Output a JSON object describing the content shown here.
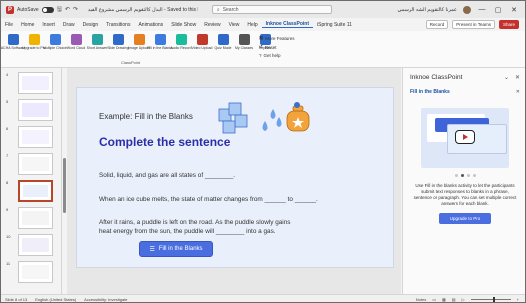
{
  "titlebar": {
    "autosave_label": "AutoSave",
    "file_title": "البدل كالتقويم الرسمي مشروع الفيد - Saved to this PC",
    "search_placeholder": "Search",
    "user_name": "عمرنا كالتقويم الشه الرسمي",
    "min": "—",
    "max": "▢",
    "close": "✕"
  },
  "menu": {
    "tabs": [
      "File",
      "Home",
      "Insert",
      "Draw",
      "Design",
      "Transitions",
      "Animations",
      "Slide Show",
      "Review",
      "View",
      "Help",
      "Inknoe ClassPoint",
      "iSpring Suite 11"
    ],
    "active_index": 11,
    "record": "Record",
    "present": "Present in Teams",
    "share": "Share"
  },
  "ribbon": {
    "buttons": [
      {
        "label": "ACHA Software",
        "color": "#2f6ac9"
      },
      {
        "label": "Upgrade to Pro",
        "color": "#f0b400"
      },
      {
        "label": "Multiple Choice",
        "color": "#3d7be0"
      },
      {
        "label": "Word Cloud",
        "color": "#9b59b6"
      },
      {
        "label": "Short Answer",
        "color": "#2aa3a3"
      },
      {
        "label": "Slide Drawing",
        "color": "#2f6ac9"
      },
      {
        "label": "Image Upload",
        "color": "#e67e22"
      },
      {
        "label": "Fill in the Blanks",
        "color": "#3d7be0"
      },
      {
        "label": "Audio Record",
        "color": "#1abc9c"
      },
      {
        "label": "Video Upload",
        "color": "#c0392b"
      },
      {
        "label": "Quiz Mode",
        "color": "#2f6ac9"
      },
      {
        "label": "My Classes",
        "color": "#555555"
      },
      {
        "label": "Reports",
        "color": "#2f6ac9"
      }
    ],
    "group_label": "ClassPoint",
    "more_features": "More Features",
    "reset": "Reset",
    "get_help": "Get help"
  },
  "thumbs": {
    "numbers": [
      "4",
      "5",
      "6",
      "7",
      "8",
      "9",
      "10",
      "11"
    ],
    "active_index": 4
  },
  "slide": {
    "example": "Example: Fill in the Blanks",
    "title": "Complete the sentence",
    "line1": "Solid, liquid, and gas are all states of ________.",
    "line2": "When an ice cube melts, the state of matter changes from ______ to ______.",
    "line3a": "After it rains, a puddle is left on the road. As the puddle slowly gains",
    "line3b": "heat energy from the sun, the puddle will ________ into a gas.",
    "button": "Fill in the Blanks"
  },
  "panel": {
    "title": "Inknoe ClassPoint",
    "subtitle": "Fill in the Blanks",
    "description": "Use Fill in the blanks activity to let the participants submit text responses to blanks in a phrase, sentence or paragraph. You can set multiple correct answers for each blank.",
    "upgrade": "Upgrade to Pro",
    "dots_count": 4,
    "active_dot": 1
  },
  "status": {
    "slide_info": "Slide 8 of 13",
    "language": "English (United States)",
    "accessibility": "Accessibility: Investigate",
    "notes": "Notes",
    "zoom": "+"
  }
}
